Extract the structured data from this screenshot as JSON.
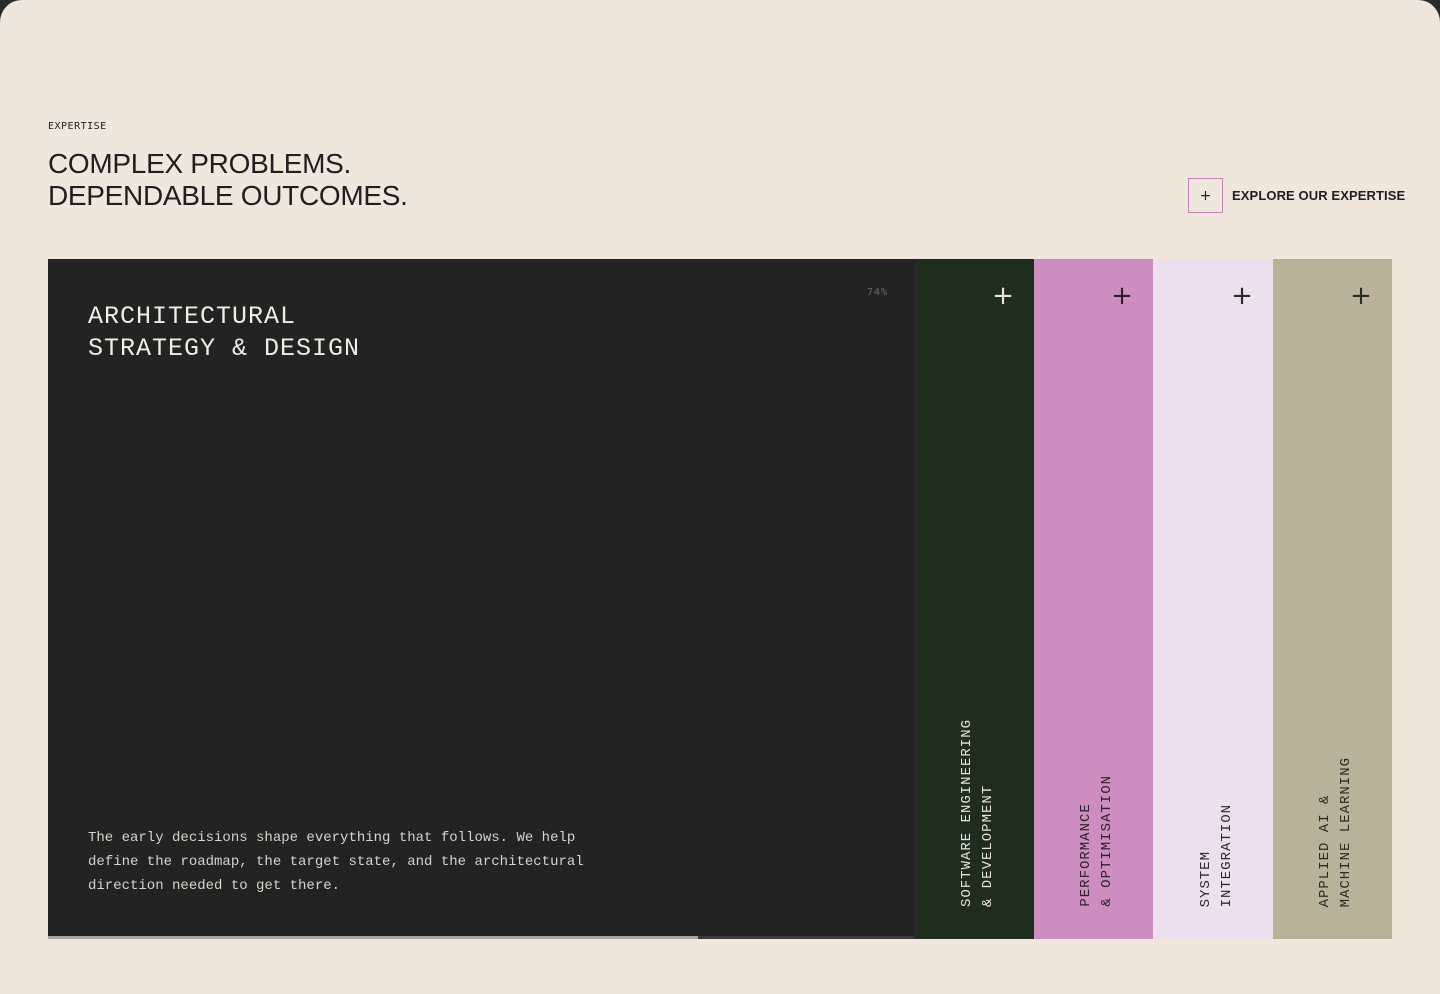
{
  "section": {
    "eyebrow": "EXPERTISE",
    "headline_line1": "COMPLEX PROBLEMS.",
    "headline_line2": "DEPENDABLE OUTCOMES."
  },
  "explore": {
    "icon": "plus-icon",
    "label": "EXPLORE OUR EXPERTISE",
    "accent": "#c583b8"
  },
  "active_panel": {
    "title_line1": "ARCHITECTURAL",
    "title_line2": "STRATEGY & DESIGN",
    "progress_label": "74%",
    "progress": 0.75,
    "description": "The early decisions shape everything that follows. We help define the roadmap, the target state, and the architectural direction needed to get there.",
    "bg": "#232323"
  },
  "side_panels": [
    {
      "line1": "SOFTWARE ENGINEERING",
      "line2": "& DEVELOPMENT",
      "icon": "plus-icon",
      "bg": "#1f2d1f",
      "fg": "#e9e4da"
    },
    {
      "line1": "PERFORMANCE",
      "line2": "& OPTIMISATION",
      "icon": "plus-icon",
      "bg": "#cd8dc0",
      "fg": "#2a2228"
    },
    {
      "line1": "SYSTEM",
      "line2": "INTEGRATION",
      "icon": "plus-icon",
      "bg": "#ecdfee",
      "fg": "#2b2b2b"
    },
    {
      "line1": "APPLIED AI &",
      "line2": "MACHINE LEARNING",
      "icon": "plus-icon",
      "bg": "#b8b29b",
      "fg": "#2a2a24"
    }
  ]
}
